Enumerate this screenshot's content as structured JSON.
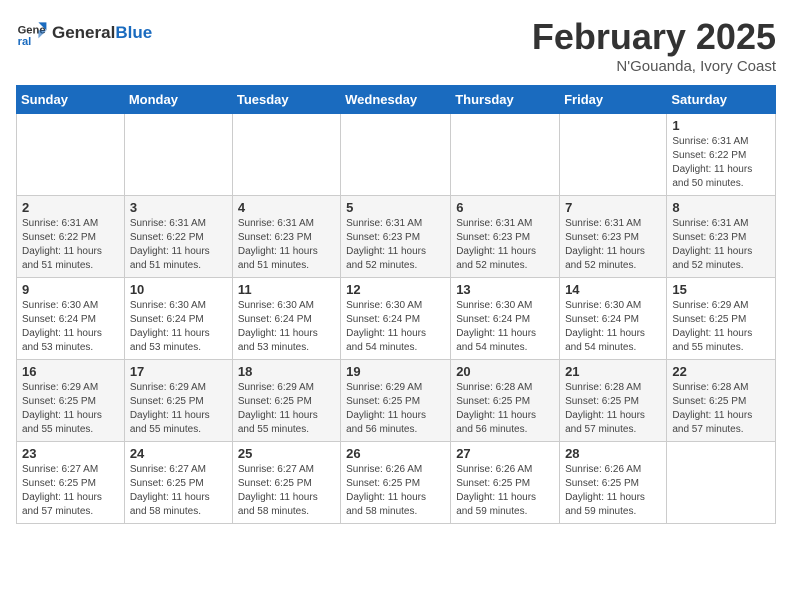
{
  "header": {
    "logo_general": "General",
    "logo_blue": "Blue",
    "title": "February 2025",
    "location": "N'Gouanda, Ivory Coast"
  },
  "weekdays": [
    "Sunday",
    "Monday",
    "Tuesday",
    "Wednesday",
    "Thursday",
    "Friday",
    "Saturday"
  ],
  "weeks": [
    [
      {
        "day": "",
        "info": ""
      },
      {
        "day": "",
        "info": ""
      },
      {
        "day": "",
        "info": ""
      },
      {
        "day": "",
        "info": ""
      },
      {
        "day": "",
        "info": ""
      },
      {
        "day": "",
        "info": ""
      },
      {
        "day": "1",
        "info": "Sunrise: 6:31 AM\nSunset: 6:22 PM\nDaylight: 11 hours and 50 minutes."
      }
    ],
    [
      {
        "day": "2",
        "info": "Sunrise: 6:31 AM\nSunset: 6:22 PM\nDaylight: 11 hours and 51 minutes."
      },
      {
        "day": "3",
        "info": "Sunrise: 6:31 AM\nSunset: 6:22 PM\nDaylight: 11 hours and 51 minutes."
      },
      {
        "day": "4",
        "info": "Sunrise: 6:31 AM\nSunset: 6:23 PM\nDaylight: 11 hours and 51 minutes."
      },
      {
        "day": "5",
        "info": "Sunrise: 6:31 AM\nSunset: 6:23 PM\nDaylight: 11 hours and 52 minutes."
      },
      {
        "day": "6",
        "info": "Sunrise: 6:31 AM\nSunset: 6:23 PM\nDaylight: 11 hours and 52 minutes."
      },
      {
        "day": "7",
        "info": "Sunrise: 6:31 AM\nSunset: 6:23 PM\nDaylight: 11 hours and 52 minutes."
      },
      {
        "day": "8",
        "info": "Sunrise: 6:31 AM\nSunset: 6:23 PM\nDaylight: 11 hours and 52 minutes."
      }
    ],
    [
      {
        "day": "9",
        "info": "Sunrise: 6:30 AM\nSunset: 6:24 PM\nDaylight: 11 hours and 53 minutes."
      },
      {
        "day": "10",
        "info": "Sunrise: 6:30 AM\nSunset: 6:24 PM\nDaylight: 11 hours and 53 minutes."
      },
      {
        "day": "11",
        "info": "Sunrise: 6:30 AM\nSunset: 6:24 PM\nDaylight: 11 hours and 53 minutes."
      },
      {
        "day": "12",
        "info": "Sunrise: 6:30 AM\nSunset: 6:24 PM\nDaylight: 11 hours and 54 minutes."
      },
      {
        "day": "13",
        "info": "Sunrise: 6:30 AM\nSunset: 6:24 PM\nDaylight: 11 hours and 54 minutes."
      },
      {
        "day": "14",
        "info": "Sunrise: 6:30 AM\nSunset: 6:24 PM\nDaylight: 11 hours and 54 minutes."
      },
      {
        "day": "15",
        "info": "Sunrise: 6:29 AM\nSunset: 6:25 PM\nDaylight: 11 hours and 55 minutes."
      }
    ],
    [
      {
        "day": "16",
        "info": "Sunrise: 6:29 AM\nSunset: 6:25 PM\nDaylight: 11 hours and 55 minutes."
      },
      {
        "day": "17",
        "info": "Sunrise: 6:29 AM\nSunset: 6:25 PM\nDaylight: 11 hours and 55 minutes."
      },
      {
        "day": "18",
        "info": "Sunrise: 6:29 AM\nSunset: 6:25 PM\nDaylight: 11 hours and 55 minutes."
      },
      {
        "day": "19",
        "info": "Sunrise: 6:29 AM\nSunset: 6:25 PM\nDaylight: 11 hours and 56 minutes."
      },
      {
        "day": "20",
        "info": "Sunrise: 6:28 AM\nSunset: 6:25 PM\nDaylight: 11 hours and 56 minutes."
      },
      {
        "day": "21",
        "info": "Sunrise: 6:28 AM\nSunset: 6:25 PM\nDaylight: 11 hours and 57 minutes."
      },
      {
        "day": "22",
        "info": "Sunrise: 6:28 AM\nSunset: 6:25 PM\nDaylight: 11 hours and 57 minutes."
      }
    ],
    [
      {
        "day": "23",
        "info": "Sunrise: 6:27 AM\nSunset: 6:25 PM\nDaylight: 11 hours and 57 minutes."
      },
      {
        "day": "24",
        "info": "Sunrise: 6:27 AM\nSunset: 6:25 PM\nDaylight: 11 hours and 58 minutes."
      },
      {
        "day": "25",
        "info": "Sunrise: 6:27 AM\nSunset: 6:25 PM\nDaylight: 11 hours and 58 minutes."
      },
      {
        "day": "26",
        "info": "Sunrise: 6:26 AM\nSunset: 6:25 PM\nDaylight: 11 hours and 58 minutes."
      },
      {
        "day": "27",
        "info": "Sunrise: 6:26 AM\nSunset: 6:25 PM\nDaylight: 11 hours and 59 minutes."
      },
      {
        "day": "28",
        "info": "Sunrise: 6:26 AM\nSunset: 6:25 PM\nDaylight: 11 hours and 59 minutes."
      },
      {
        "day": "",
        "info": ""
      }
    ]
  ]
}
